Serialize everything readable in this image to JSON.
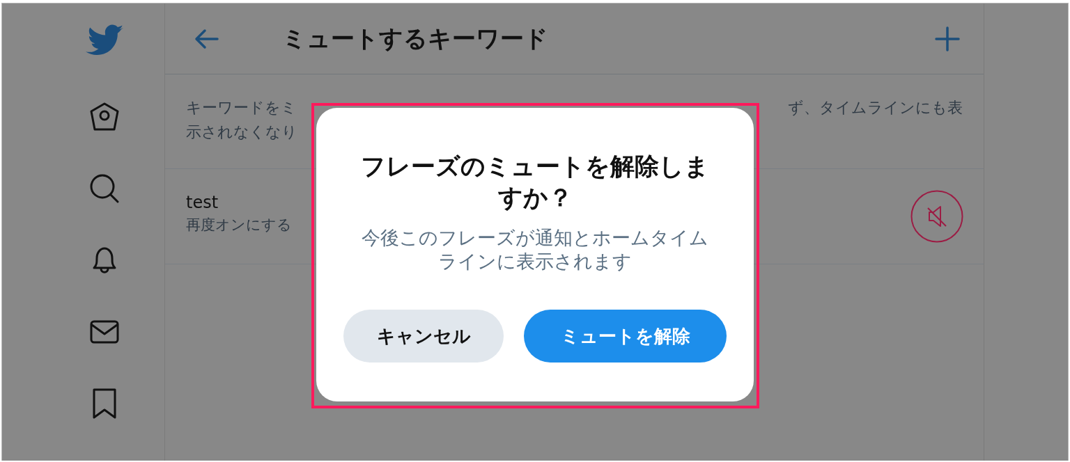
{
  "header": {
    "title": "ミュートするキーワード"
  },
  "description": {
    "line_1": {
      "start": "キーワードをミ",
      "end": "ず、タイムラインにも表"
    },
    "line_2": {
      "start": "示されなくなり"
    }
  },
  "muted_words": [
    {
      "word": "test",
      "hint": "再度オンにする",
      "muted": true
    }
  ],
  "dialog": {
    "title": "フレーズのミュートを解除しますか？",
    "message": "今後このフレーズが通知とホームタイムラインに表示されます",
    "buttons": [
      {
        "label": "キャンセル",
        "kind": "secondary"
      },
      {
        "label": "ミュートを解除",
        "kind": "primary"
      }
    ]
  }
}
